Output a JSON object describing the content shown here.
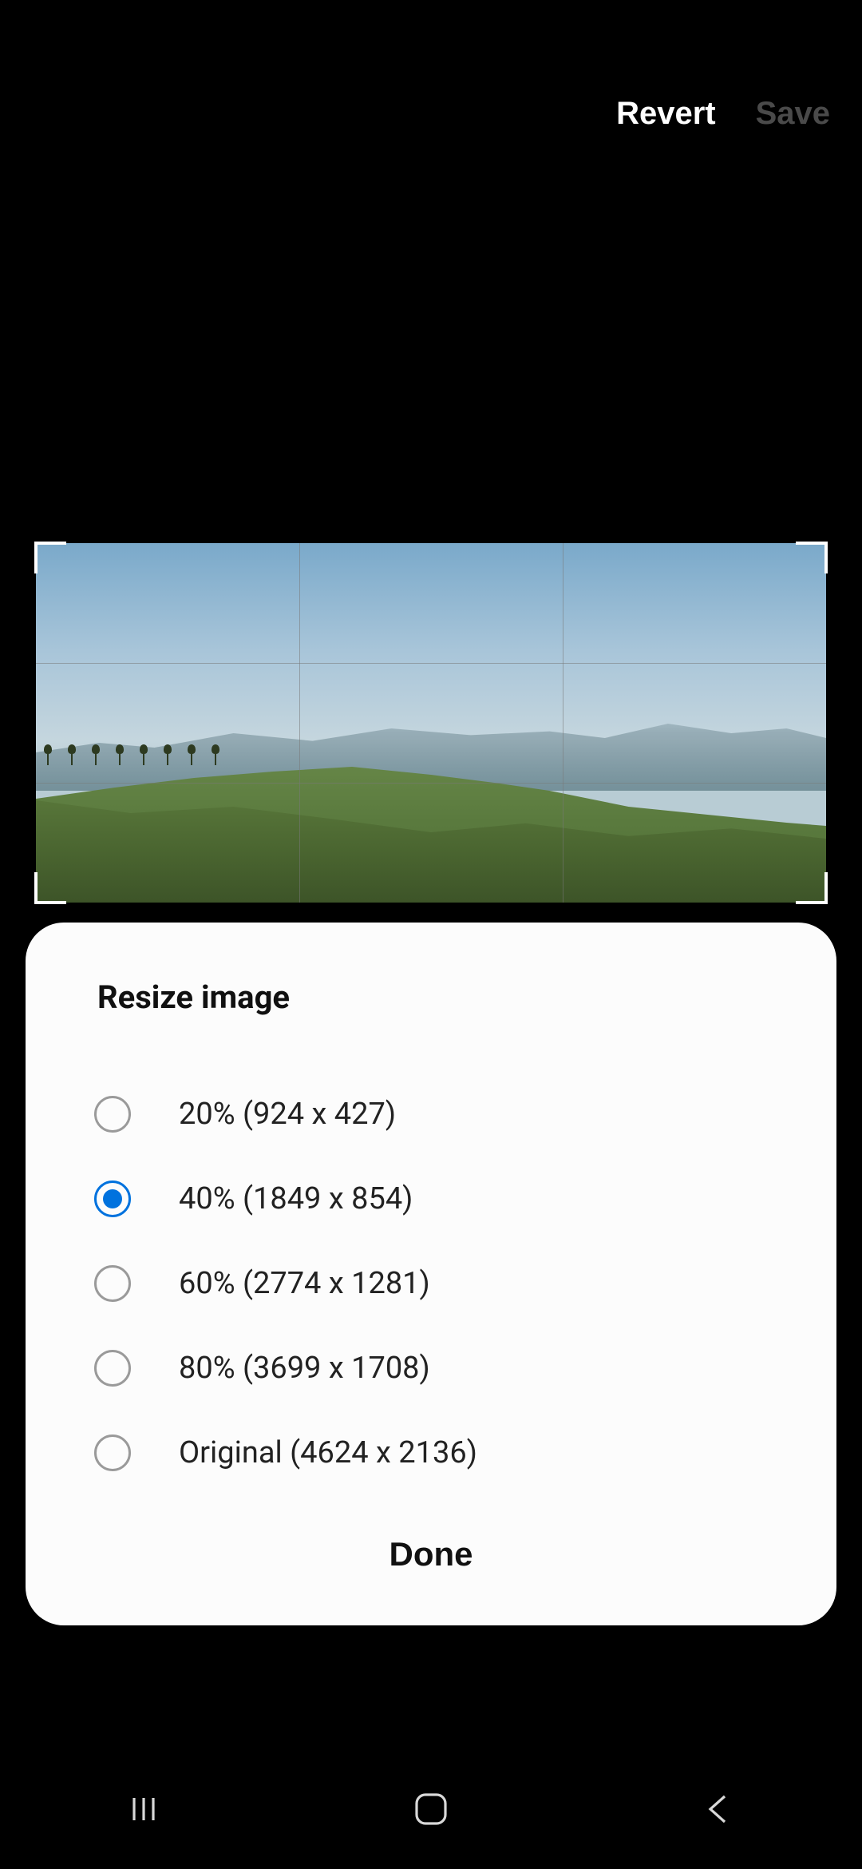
{
  "topbar": {
    "revert_label": "Revert",
    "save_label": "Save"
  },
  "sheet": {
    "title": "Resize image",
    "done_label": "Done",
    "options": [
      {
        "label": "20% (924 x 427)",
        "selected": false
      },
      {
        "label": "40% (1849 x 854)",
        "selected": true
      },
      {
        "label": "60% (2774 x 1281)",
        "selected": false
      },
      {
        "label": "80% (3699 x 1708)",
        "selected": false
      },
      {
        "label": "Original (4624 x 2136)",
        "selected": false
      }
    ]
  },
  "nav": {
    "recents": "recents",
    "home": "home",
    "back": "back"
  }
}
